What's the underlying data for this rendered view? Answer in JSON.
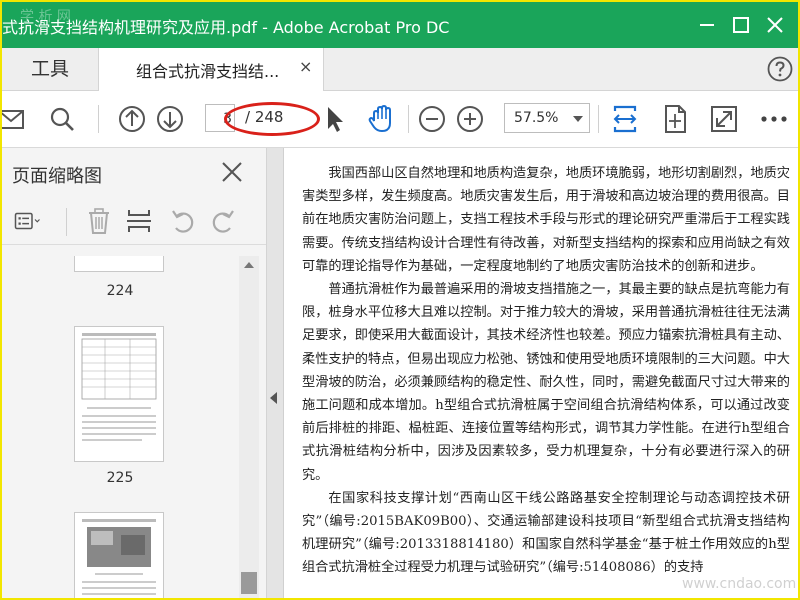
{
  "window": {
    "title": "式抗滑支挡结构机理研究及应用.pdf - Adobe Acrobat Pro DC",
    "watermark": "学 析 网"
  },
  "tabs": {
    "tools_label": "工具",
    "document_label": "组合式抗滑支挡结...",
    "close_glyph": "×"
  },
  "toolbar": {
    "current_page": "3",
    "total_pages": "/ 248",
    "zoom": "57.5%"
  },
  "sidepanel": {
    "title": "页面缩略图",
    "thumbnails": [
      {
        "label": "224"
      },
      {
        "label": "225"
      },
      {
        "label": ""
      }
    ]
  },
  "document": {
    "paragraphs": [
      "我国西部山区自然地理和地质构造复杂，地质环境脆弱，地形切割剧烈，地质灾害类型多样，发生频度高。地质灾害发生后，用于滑坡和高边坡治理的费用很高。目前在地质灾害防治问题上，支挡工程技术手段与形式的理论研究严重滞后于工程实践需要。传统支挡结构设计合理性有待改善，对新型支挡结构的探索和应用尚缺之有效可靠的理论指导作为基础，一定程度地制约了地质灾害防治技术的创新和进步。",
      "普通抗滑桩作为最普遍采用的滑坡支挡措施之一，其最主要的缺点是抗弯能力有限，桩身水平位移大且难以控制。对于推力较大的滑坡，采用普通抗滑桩往往无法满足要求，即使采用大截面设计，其技术经济性也较差。预应力锚索抗滑桩具有主动、柔性支护的特点，但易出现应力松弛、锈蚀和使用受地质环境限制的三大问题。中大型滑坡的防治，必须兼顾结构的稳定性、耐久性，同时，需避免截面尺寸过大带来的施工问题和成本增加。h型组合式抗滑桩属于空间组合抗滑结构体系，可以通过改变前后排桩的排距、榀桩距、连接位置等结构形式，调节其力学性能。在进行h型组合式抗滑桩结构分析中，因涉及因素较多，受力机理复杂，十分有必要进行深入的研究。",
      "在国家科技支撑计划“西南山区干线公路路基安全控制理论与动态调控技术研究”（编号:2015BAK09B00）、交通运输部建设科技项目“新型组合式抗滑支挡结构机理研究”（编号:2013318814180）和国家自然科学基金“基于桩土作用效应的h型组合式抗滑桩全过程受力机理与试验研究”（编号:51408086）的支持"
    ],
    "watermark": "www.cndao.com"
  }
}
